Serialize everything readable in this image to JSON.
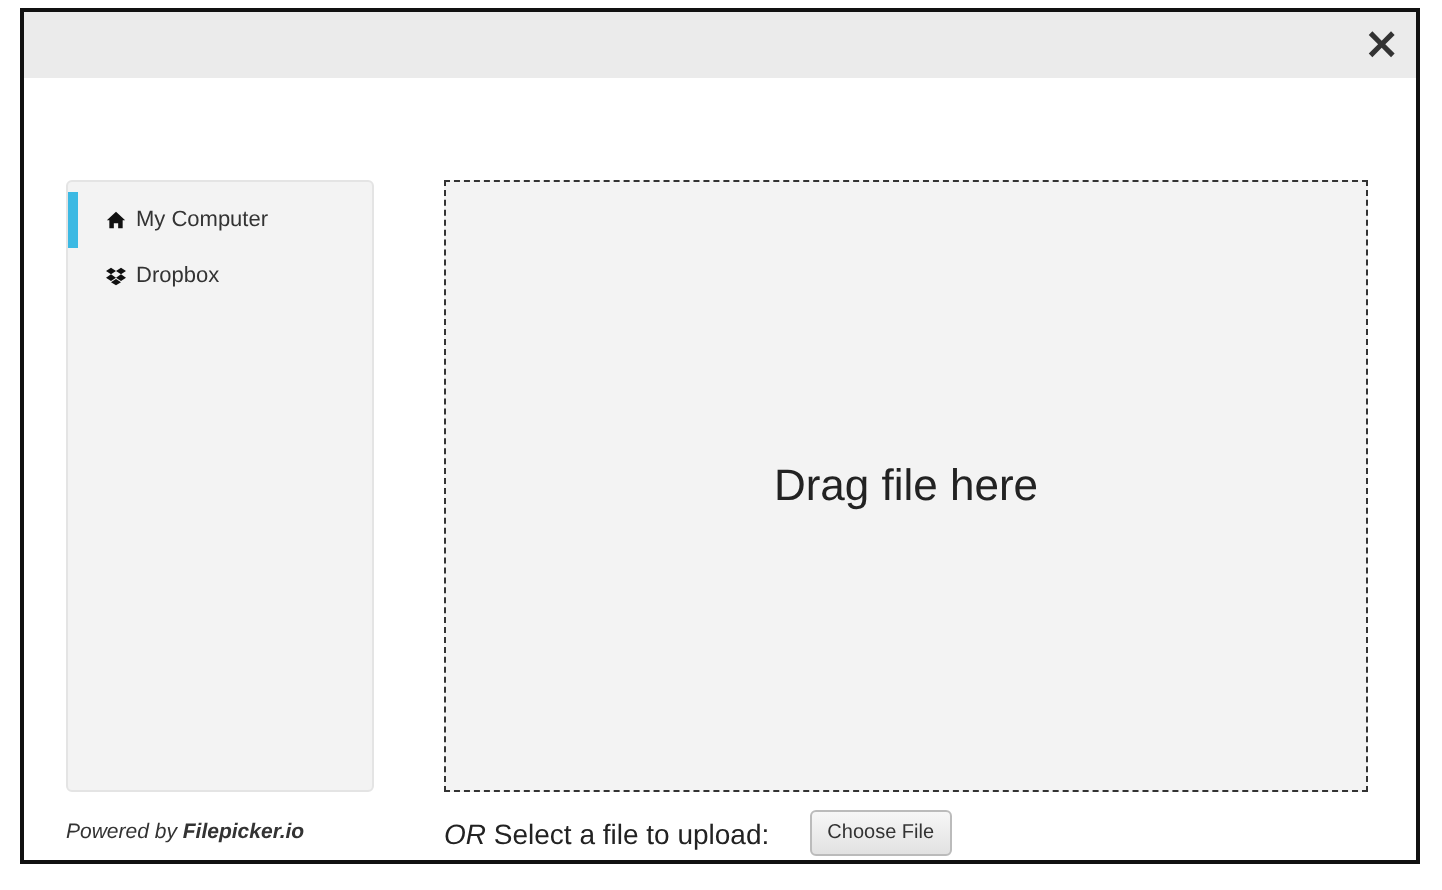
{
  "close_button": "×",
  "sources": [
    {
      "label": "My Computer",
      "kind": "home",
      "selected": true
    },
    {
      "label": "Dropbox",
      "kind": "dropbox",
      "selected": false
    }
  ],
  "powered_by": "Powered by **Filepicker.io**",
  "drop_zone": {
    "text": "Drag file here"
  },
  "select_prompt": "*OR* Select a file to upload:",
  "choose_button": "Choose File"
}
